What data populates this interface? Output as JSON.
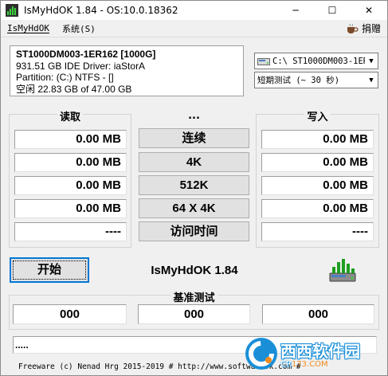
{
  "window": {
    "title": "IsMyHdOK 1.84 - OS:10.0.18362",
    "minimize": "─",
    "maximize": "☐",
    "close": "✕"
  },
  "menu": {
    "items": [
      "IsMyHdOK",
      "系统(S)"
    ],
    "right_label": "捐赠",
    "right_icon": "coffee-cup-icon"
  },
  "drive_info": {
    "model": "ST1000DM003-1ER162 [1000G]",
    "capacity": "931.51 GB  IDE Driver: iaStorA",
    "partition": "Partition: (C:) NTFS - []",
    "free": "空闲 22.83 GB of 47.00 GB"
  },
  "drive_select": {
    "value": "C:\\ ST1000DM003-1ER"
  },
  "duration_select": {
    "value": "短期测试 (~ 30 秒)"
  },
  "read_group": {
    "title": "读取",
    "values": [
      "0.00 MB",
      "0.00 MB",
      "0.00 MB",
      "0.00 MB",
      "----"
    ]
  },
  "write_group": {
    "title": "写入",
    "values": [
      "0.00 MB",
      "0.00 MB",
      "0.00 MB",
      "0.00 MB",
      "----"
    ]
  },
  "middle": {
    "dots": "...",
    "buttons": [
      "连续",
      "4K",
      "512K",
      "64 X 4K",
      "访问时间"
    ]
  },
  "start_button": "开始",
  "app_name": "IsMyHdOK 1.84",
  "benchmark": {
    "title": "基准测试",
    "values": [
      "000",
      "000",
      "000"
    ]
  },
  "status": ".....",
  "footer": "Freeware (c) Nenad Hrg 2015-2019 # http://www.softwareok.com   #",
  "watermark": {
    "main": "西西软件园",
    "sub_prefix": "CR",
    "sub_suffix": "173.COM"
  }
}
